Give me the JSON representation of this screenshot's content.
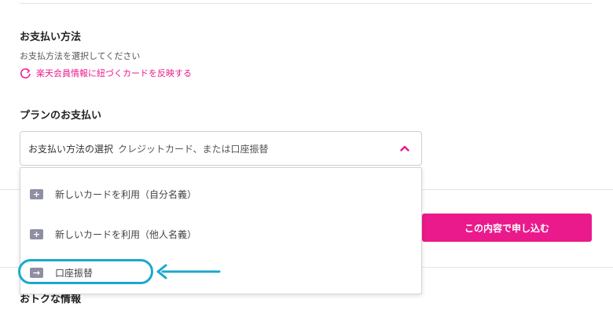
{
  "payment_method": {
    "title": "お支払い方法",
    "subtitle": "お支払方法を選択してください",
    "reflect_link": "楽天会員情報に紐づくカードを反映する",
    "reflect_icon": "refresh-icon"
  },
  "plan_payment": {
    "title": "プランのお支払い",
    "select": {
      "label": "お支払い方法の選択",
      "placeholder": "クレジットカード、または口座振替",
      "state": "expanded"
    },
    "options": [
      {
        "label": "新しいカードを利用（自分名義）",
        "icon": "card-plus-icon"
      },
      {
        "label": "新しいカードを利用（他人名義）",
        "icon": "card-plus-icon"
      },
      {
        "label": "口座振替",
        "icon": "bank-transfer-icon",
        "highlighted": true
      }
    ]
  },
  "submit": {
    "label": "この内容で申し込む"
  },
  "next_section": {
    "title": "おトクな情報"
  },
  "colors": {
    "accent": "#ea1a8c",
    "highlight": "#1ba8cf",
    "option_icon": "#8f8fa3"
  }
}
